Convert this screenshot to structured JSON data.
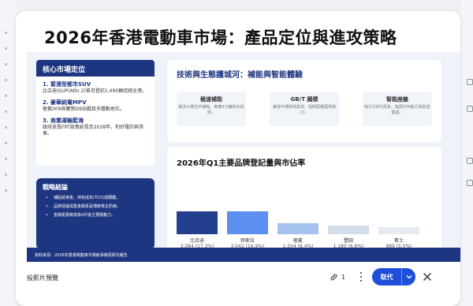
{
  "slide": {
    "title": "2026年香港電動車市場：產品定位與進攻策略",
    "core_market": {
      "header": "核心市場定位",
      "items": [
        {
          "title": "1. 緊湊型都市SUV",
          "desc": "比亞迪元UP(Atto 2)單月登記1,495輛冠絕全港。"
        },
        {
          "title": "2. 豪華純電MPV",
          "desc": "極氪009與騰勢D9佔戰目多層動地位。"
        },
        {
          "title": "3. 商業運輸藍海",
          "desc": "政府放長FRT政策延長至2028年，利好電的與貨車。"
        }
      ]
    },
    "strategy": {
      "title": "戰略結論",
      "items": [
        "補貼結束後，持有成本(TCO)成關鍵。",
        "品牌週邊與售後體系是傳統車企防線。",
        "金融租賃將成為4月後主要驅動力。"
      ]
    },
    "moat": {
      "title": "技術與生態護城河：補能與智能體驗",
      "cards": [
        {
          "title": "極速補能",
          "desc": "解決公寓住戶痛點，推廣5分鐘快充技術。"
        },
        {
          "title": "GB/T 國標",
          "desc": "兼容中港跨境需求，強制配備國標接口。"
        },
        {
          "title": "智能座艙",
          "desc": "吸引Z世代買家，強調OTA能力與影音集成。"
        }
      ]
    },
    "chart": {
      "title": "2026年Q1主要品牌登記量與市佔率"
    },
    "footer": "資料來源：2026年香港電動車市場競爭格局研究報告"
  },
  "chart_data": {
    "type": "bar",
    "title": "2026年Q1主要品牌登記量與市佔率",
    "categories": [
      "比亞迪",
      "特斯拉",
      "極氪",
      "豐田",
      "賓士"
    ],
    "values": [
      3084,
      3042,
      1504,
      1180,
      989
    ],
    "value_labels": [
      "3,084 (17.3%)",
      "3,042 (16.9%)",
      "1,504 (8.4%)",
      "1,180 (6.6%)",
      "989 (5.5%)"
    ],
    "colors": [
      "#253f8f",
      "#5b8ff0",
      "#a6c2ef",
      "#d2dcea",
      "#e6ebf2"
    ],
    "ylim": [
      0,
      3500
    ]
  },
  "toolbar": {
    "label": "投影片預覽",
    "link_count": "1",
    "copy_label": "取代",
    "accent": "#1d4fd8"
  },
  "icons": [
    "link-icon",
    "more-vert-icon",
    "chevron-down-icon",
    "close-icon"
  ]
}
